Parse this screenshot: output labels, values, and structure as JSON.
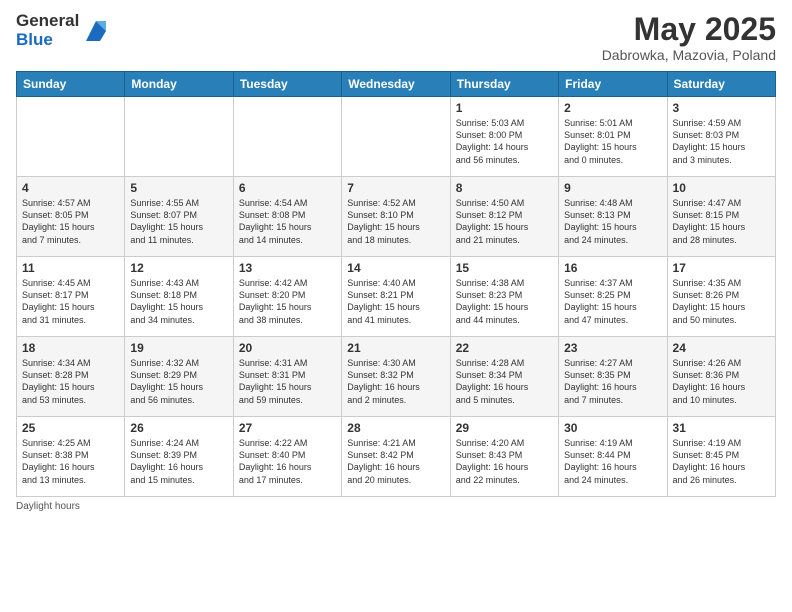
{
  "header": {
    "logo_line1": "General",
    "logo_line2": "Blue",
    "month_year": "May 2025",
    "location": "Dabrowka, Mazovia, Poland"
  },
  "weekdays": [
    "Sunday",
    "Monday",
    "Tuesday",
    "Wednesday",
    "Thursday",
    "Friday",
    "Saturday"
  ],
  "weeks": [
    [
      {
        "day": "",
        "info": ""
      },
      {
        "day": "",
        "info": ""
      },
      {
        "day": "",
        "info": ""
      },
      {
        "day": "",
        "info": ""
      },
      {
        "day": "1",
        "info": "Sunrise: 5:03 AM\nSunset: 8:00 PM\nDaylight: 14 hours\nand 56 minutes."
      },
      {
        "day": "2",
        "info": "Sunrise: 5:01 AM\nSunset: 8:01 PM\nDaylight: 15 hours\nand 0 minutes."
      },
      {
        "day": "3",
        "info": "Sunrise: 4:59 AM\nSunset: 8:03 PM\nDaylight: 15 hours\nand 3 minutes."
      }
    ],
    [
      {
        "day": "4",
        "info": "Sunrise: 4:57 AM\nSunset: 8:05 PM\nDaylight: 15 hours\nand 7 minutes."
      },
      {
        "day": "5",
        "info": "Sunrise: 4:55 AM\nSunset: 8:07 PM\nDaylight: 15 hours\nand 11 minutes."
      },
      {
        "day": "6",
        "info": "Sunrise: 4:54 AM\nSunset: 8:08 PM\nDaylight: 15 hours\nand 14 minutes."
      },
      {
        "day": "7",
        "info": "Sunrise: 4:52 AM\nSunset: 8:10 PM\nDaylight: 15 hours\nand 18 minutes."
      },
      {
        "day": "8",
        "info": "Sunrise: 4:50 AM\nSunset: 8:12 PM\nDaylight: 15 hours\nand 21 minutes."
      },
      {
        "day": "9",
        "info": "Sunrise: 4:48 AM\nSunset: 8:13 PM\nDaylight: 15 hours\nand 24 minutes."
      },
      {
        "day": "10",
        "info": "Sunrise: 4:47 AM\nSunset: 8:15 PM\nDaylight: 15 hours\nand 28 minutes."
      }
    ],
    [
      {
        "day": "11",
        "info": "Sunrise: 4:45 AM\nSunset: 8:17 PM\nDaylight: 15 hours\nand 31 minutes."
      },
      {
        "day": "12",
        "info": "Sunrise: 4:43 AM\nSunset: 8:18 PM\nDaylight: 15 hours\nand 34 minutes."
      },
      {
        "day": "13",
        "info": "Sunrise: 4:42 AM\nSunset: 8:20 PM\nDaylight: 15 hours\nand 38 minutes."
      },
      {
        "day": "14",
        "info": "Sunrise: 4:40 AM\nSunset: 8:21 PM\nDaylight: 15 hours\nand 41 minutes."
      },
      {
        "day": "15",
        "info": "Sunrise: 4:38 AM\nSunset: 8:23 PM\nDaylight: 15 hours\nand 44 minutes."
      },
      {
        "day": "16",
        "info": "Sunrise: 4:37 AM\nSunset: 8:25 PM\nDaylight: 15 hours\nand 47 minutes."
      },
      {
        "day": "17",
        "info": "Sunrise: 4:35 AM\nSunset: 8:26 PM\nDaylight: 15 hours\nand 50 minutes."
      }
    ],
    [
      {
        "day": "18",
        "info": "Sunrise: 4:34 AM\nSunset: 8:28 PM\nDaylight: 15 hours\nand 53 minutes."
      },
      {
        "day": "19",
        "info": "Sunrise: 4:32 AM\nSunset: 8:29 PM\nDaylight: 15 hours\nand 56 minutes."
      },
      {
        "day": "20",
        "info": "Sunrise: 4:31 AM\nSunset: 8:31 PM\nDaylight: 15 hours\nand 59 minutes."
      },
      {
        "day": "21",
        "info": "Sunrise: 4:30 AM\nSunset: 8:32 PM\nDaylight: 16 hours\nand 2 minutes."
      },
      {
        "day": "22",
        "info": "Sunrise: 4:28 AM\nSunset: 8:34 PM\nDaylight: 16 hours\nand 5 minutes."
      },
      {
        "day": "23",
        "info": "Sunrise: 4:27 AM\nSunset: 8:35 PM\nDaylight: 16 hours\nand 7 minutes."
      },
      {
        "day": "24",
        "info": "Sunrise: 4:26 AM\nSunset: 8:36 PM\nDaylight: 16 hours\nand 10 minutes."
      }
    ],
    [
      {
        "day": "25",
        "info": "Sunrise: 4:25 AM\nSunset: 8:38 PM\nDaylight: 16 hours\nand 13 minutes."
      },
      {
        "day": "26",
        "info": "Sunrise: 4:24 AM\nSunset: 8:39 PM\nDaylight: 16 hours\nand 15 minutes."
      },
      {
        "day": "27",
        "info": "Sunrise: 4:22 AM\nSunset: 8:40 PM\nDaylight: 16 hours\nand 17 minutes."
      },
      {
        "day": "28",
        "info": "Sunrise: 4:21 AM\nSunset: 8:42 PM\nDaylight: 16 hours\nand 20 minutes."
      },
      {
        "day": "29",
        "info": "Sunrise: 4:20 AM\nSunset: 8:43 PM\nDaylight: 16 hours\nand 22 minutes."
      },
      {
        "day": "30",
        "info": "Sunrise: 4:19 AM\nSunset: 8:44 PM\nDaylight: 16 hours\nand 24 minutes."
      },
      {
        "day": "31",
        "info": "Sunrise: 4:19 AM\nSunset: 8:45 PM\nDaylight: 16 hours\nand 26 minutes."
      }
    ]
  ],
  "footer": {
    "daylight_label": "Daylight hours"
  }
}
